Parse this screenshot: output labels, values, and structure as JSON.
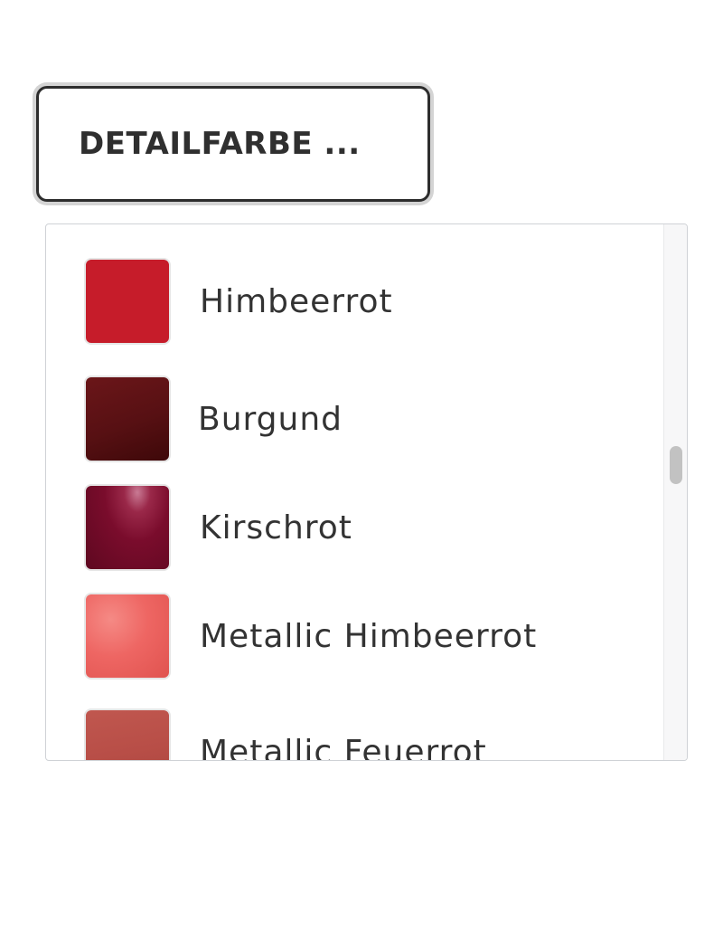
{
  "selector": {
    "label": "DETAILFARBE ..."
  },
  "colors": {
    "button_border": "#2d2d2d",
    "button_outline": "#d4d4d4",
    "panel_border": "#cfd2d6",
    "text": "#333333"
  },
  "options": [
    {
      "label": "Himbeerrot",
      "swatch_color": "#c61c2a",
      "swatch_icon": "solid-swatch"
    },
    {
      "label": "Burgund",
      "swatch_color": "#5c1114",
      "swatch_icon": "solid-swatch"
    },
    {
      "label": "Kirschrot",
      "swatch_color": "#7a0c2c",
      "swatch_icon": "glossy-swatch"
    },
    {
      "label": "Metallic Himbeerrot",
      "swatch_color": "#ee6663",
      "swatch_icon": "metallic-swatch"
    },
    {
      "label": "Metallic Feuerrot",
      "swatch_color": "#b84e47",
      "swatch_icon": "metallic-swatch"
    }
  ]
}
